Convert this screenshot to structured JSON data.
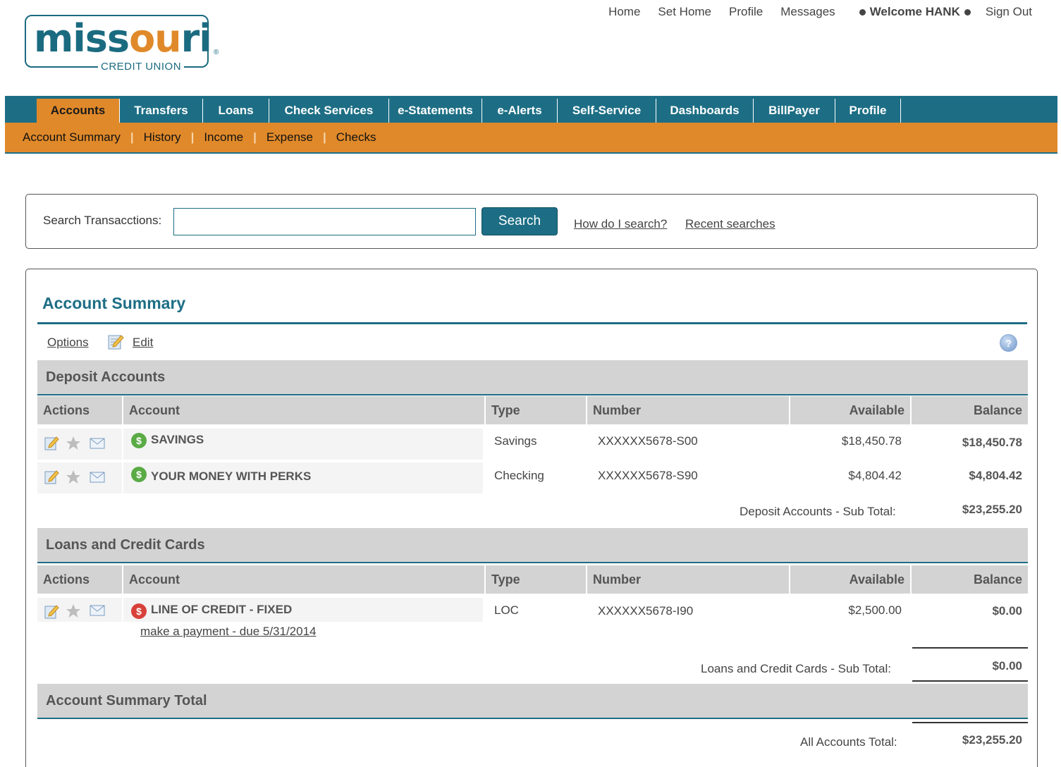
{
  "top_links": {
    "home": "Home",
    "set_home": "Set Home",
    "profile": "Profile",
    "messages": "Messages",
    "welcome": "Welcome HANK",
    "sign_out": "Sign Out"
  },
  "logo": {
    "word_main": "missouri",
    "credit_union": "CREDIT UNION",
    "registered": "®"
  },
  "main_nav": {
    "tabs": [
      {
        "label": "Accounts",
        "active": true
      },
      {
        "label": "Transfers"
      },
      {
        "label": "Loans"
      },
      {
        "label": "Check Services"
      },
      {
        "label": "e-Statements"
      },
      {
        "label": "e-Alerts"
      },
      {
        "label": "Self-Service"
      },
      {
        "label": "Dashboards"
      },
      {
        "label": "BillPayer"
      },
      {
        "label": "Profile"
      }
    ]
  },
  "sub_nav": {
    "items": [
      "Account Summary",
      "History",
      "Income",
      "Expense",
      "Checks"
    ]
  },
  "search": {
    "label": "Search Transacctions:",
    "value": "",
    "button": "Search",
    "how_link": "How do I search?",
    "recent_link": "Recent searches"
  },
  "summary": {
    "title": "Account Summary",
    "options": "Options",
    "edit": "Edit",
    "help_icon": "?"
  },
  "columns": {
    "actions": "Actions",
    "account": "Account",
    "type": "Type",
    "number": "Number",
    "available": "Available",
    "balance": "Balance"
  },
  "deposit": {
    "heading": "Deposit Accounts",
    "rows": [
      {
        "name": "SAVINGS",
        "type": "Savings",
        "number": "XXXXXX5678-S00",
        "available": "$18,450.78",
        "balance": "$18,450.78"
      },
      {
        "name": "YOUR MONEY WITH PERKS",
        "type": "Checking",
        "number": "XXXXXX5678-S90",
        "available": "$4,804.42",
        "balance": "$4,804.42"
      }
    ],
    "subtotal_label": "Deposit Accounts - Sub Total:",
    "subtotal_value": "$23,255.20"
  },
  "loans": {
    "heading": "Loans and Credit Cards",
    "rows": [
      {
        "name": "LINE OF CREDIT - FIXED",
        "type": "LOC",
        "number": "XXXXXX5678-I90",
        "available": "$2,500.00",
        "balance": "$0.00",
        "payment_link": "make a payment - due 5/31/2014"
      }
    ],
    "subtotal_label": "Loans and Credit Cards - Sub Total:",
    "subtotal_value": "$0.00"
  },
  "total": {
    "heading": "Account Summary Total",
    "label": "All Accounts Total:",
    "value": "$23,255.20"
  },
  "icons": {
    "account_icon_symbol": "$",
    "colors": {
      "teal": "#1d6e85",
      "orange": "#e0892a",
      "green": "#5aab46",
      "red": "#d8403a"
    }
  }
}
